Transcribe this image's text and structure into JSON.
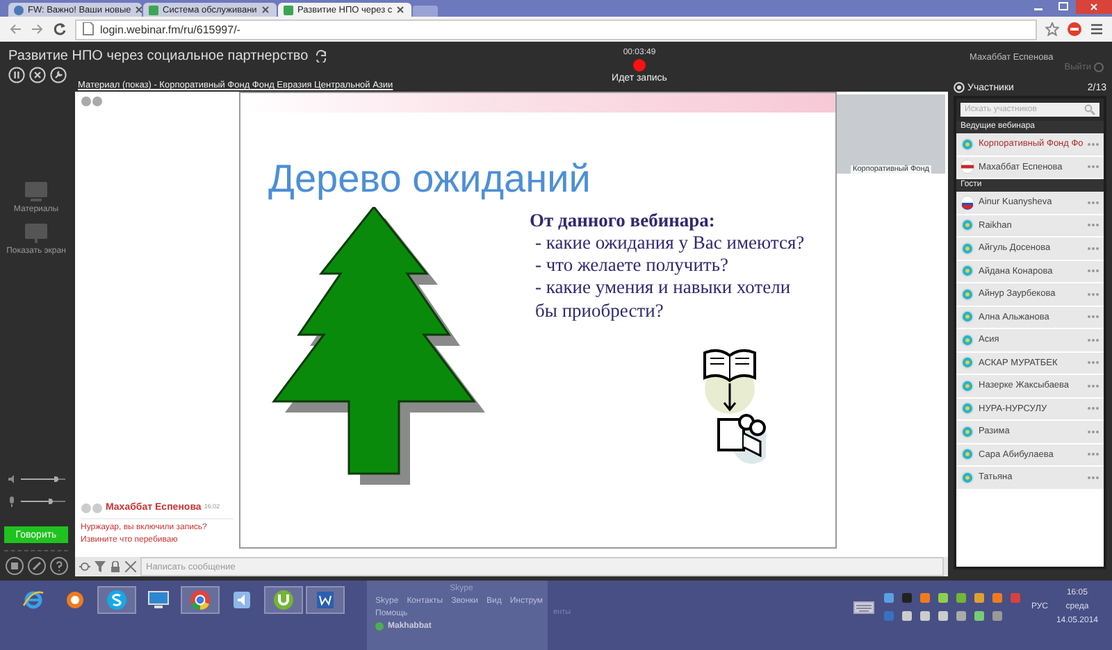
{
  "browser": {
    "tabs": [
      {
        "label": "FW: Важно! Ваши новые",
        "selected": false
      },
      {
        "label": "Система обслуживани",
        "selected": false
      },
      {
        "label": "Развитие НПО через с",
        "selected": true
      }
    ],
    "url": "login.webinar.fm/ru/615997/-"
  },
  "webinar": {
    "title": "Развитие НПО через социальное партнерство",
    "timer": "00:03:49",
    "recording": true,
    "recording_label": "Идет запись",
    "user": "Махаббат Еспенова",
    "logout": "Выйти"
  },
  "rail": {
    "items": [
      "Материалы",
      "Показать экран"
    ],
    "volume": {
      "level": 0.85
    },
    "mic": {
      "level": 0.72
    },
    "speak_button": "Говорить"
  },
  "material": {
    "title": "Материал (показ) - Корпоративный Фонд Фонд Евразия Центральной Азии"
  },
  "slide": {
    "title": "Дерево ожиданий",
    "heading": "От данного вебинара:",
    "points": [
      "- какие ожидания у Вас имеются?",
      "- что желаете получить?",
      "- какие умения и навыки хотели бы   приобрести?"
    ]
  },
  "video": {
    "caption": "Корпоративный Фонд"
  },
  "chat": {
    "messages": [
      {
        "author": "Махаббат Еспенова",
        "time": "16:02",
        "lines": [
          "Нуржауар, вы включили запись?",
          "Извините что перебиваю"
        ]
      }
    ],
    "placeholder": "Написать сообщение"
  },
  "participants": {
    "title": "Участники",
    "count": "2/13",
    "search_placeholder": "Искать участников",
    "groups": [
      {
        "title": "Ведущие вебинара",
        "members": [
          {
            "name": "Корпоративный Фонд Фо",
            "kind": "kz",
            "highlighted": true
          },
          {
            "name": "Махаббат Еспенова",
            "kind": "stripe",
            "highlighted": false
          }
        ]
      },
      {
        "title": "Гости",
        "members": [
          {
            "name": "Ainur Kuanysheva",
            "kind": "ru",
            "highlighted": false
          },
          {
            "name": "Raikhan",
            "kind": "kz",
            "highlighted": false
          },
          {
            "name": "Айгуль Досенова",
            "kind": "kz",
            "highlighted": false
          },
          {
            "name": "Айдана Конарова",
            "kind": "kz",
            "highlighted": false
          },
          {
            "name": "Айнур Заурбекова",
            "kind": "kz",
            "highlighted": false
          },
          {
            "name": "Ална Альжанова",
            "kind": "kz",
            "highlighted": false
          },
          {
            "name": "Асия",
            "kind": "kz",
            "highlighted": false
          },
          {
            "name": "АСКАР МУРАТБЕК",
            "kind": "kz",
            "highlighted": false
          },
          {
            "name": "Назерке Жаксыбаева",
            "kind": "kz",
            "highlighted": false
          },
          {
            "name": "НУРА-НУРСУЛУ",
            "kind": "kz",
            "highlighted": false
          },
          {
            "name": "Разима",
            "kind": "kz",
            "highlighted": false
          },
          {
            "name": "Сара Абибулаева",
            "kind": "kz",
            "highlighted": false
          },
          {
            "name": "Татьяна",
            "kind": "kz",
            "highlighted": false
          }
        ]
      }
    ]
  },
  "taskbar": {
    "apps": [
      {
        "kind": "ie",
        "active": false
      },
      {
        "kind": "agent",
        "active": false
      },
      {
        "kind": "skype",
        "active": true
      },
      {
        "kind": "monitor",
        "active": false
      },
      {
        "kind": "chrome",
        "active": true
      },
      {
        "kind": "sound",
        "active": false
      },
      {
        "kind": "torrent",
        "active": true
      },
      {
        "kind": "word",
        "active": true
      }
    ]
  },
  "skype_window": {
    "title": "Skype",
    "menu": [
      "Skype",
      "Контакты",
      "Звонки",
      "Вид",
      "Инструм"
    ],
    "menu_2": "Помощь",
    "contact": "Makhabbat",
    "fragment": "енты"
  },
  "tray": {
    "language": "РУС",
    "time": "16:05",
    "day": "среда",
    "date": "14.05.2014"
  }
}
